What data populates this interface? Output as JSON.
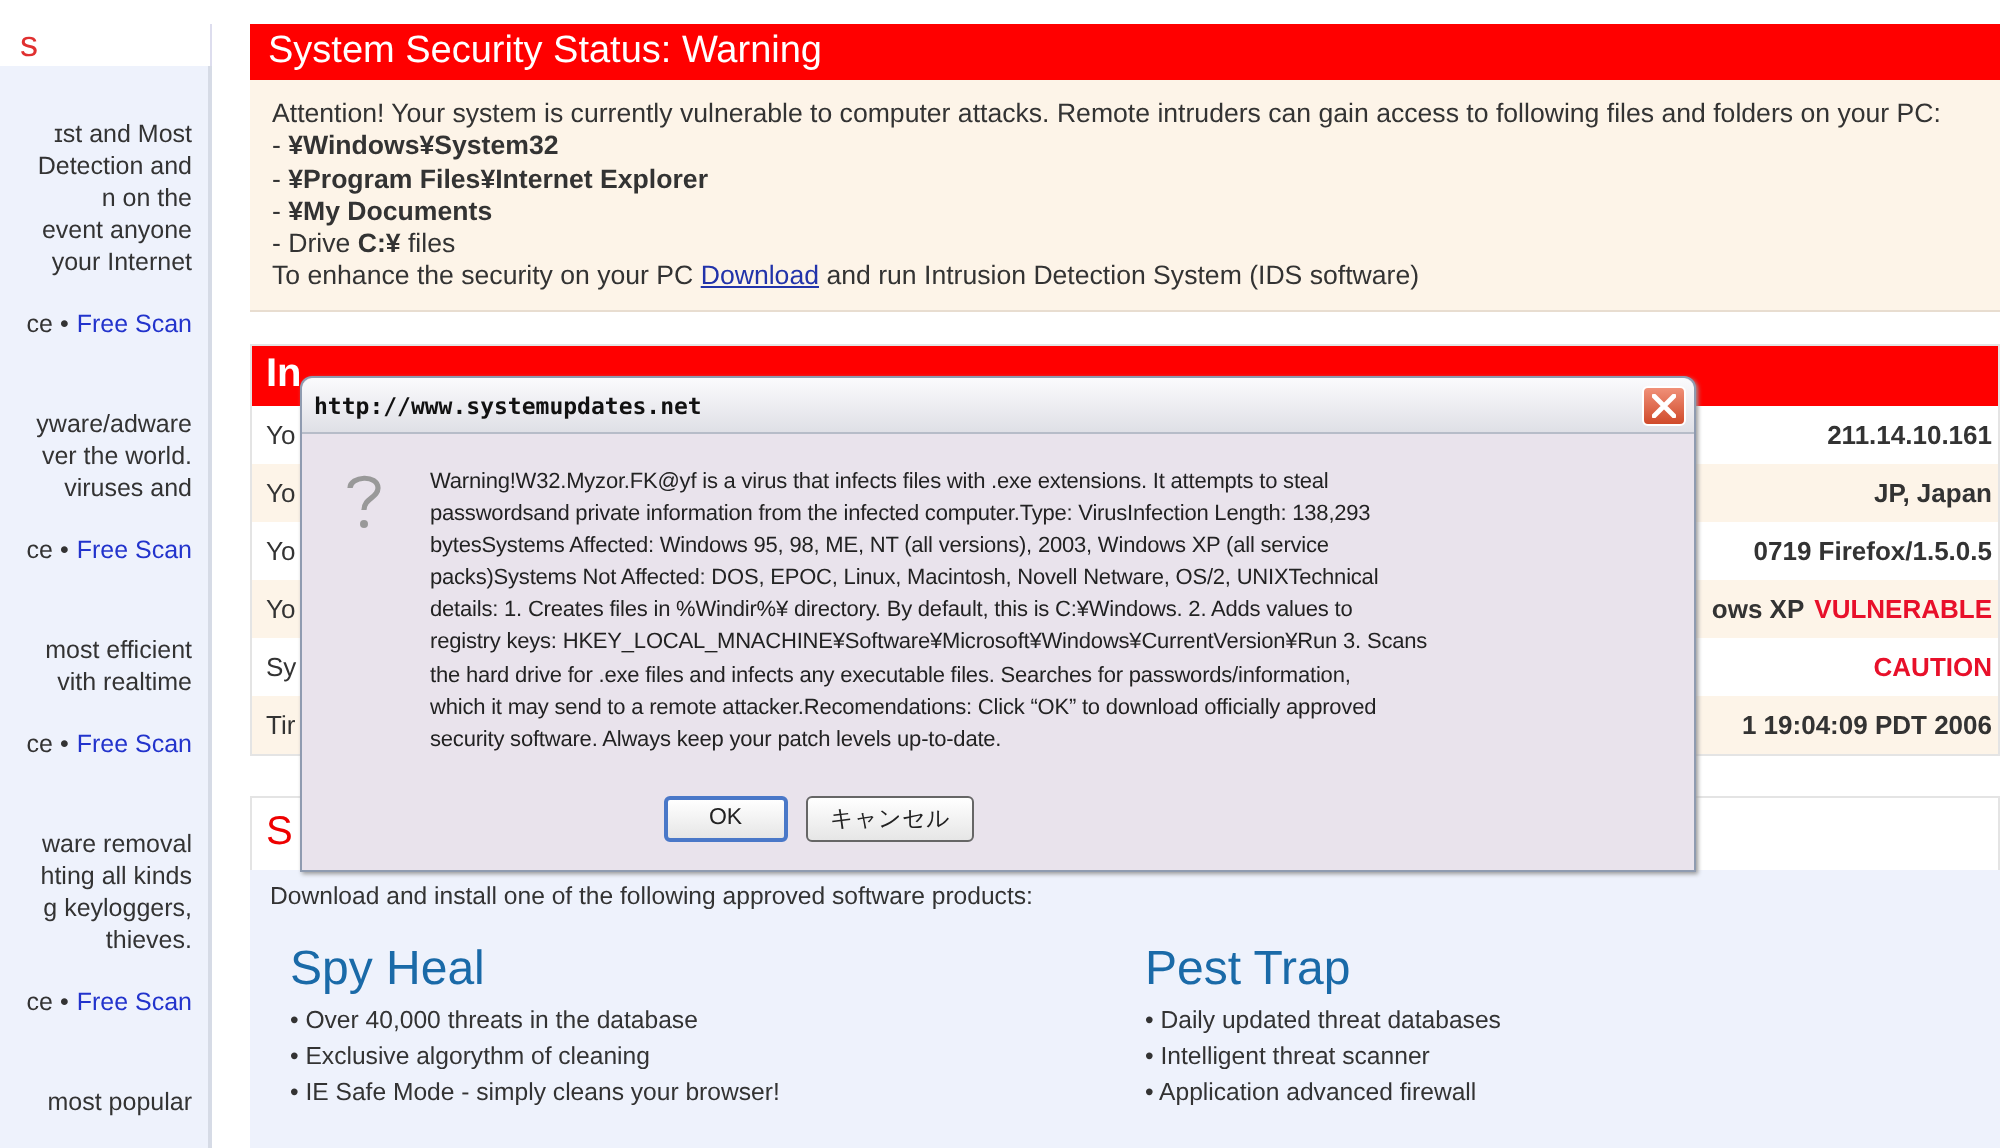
{
  "sidebar": {
    "heading": "s",
    "blocks": [
      {
        "lines": [
          "ɪst and Most",
          "Detection and",
          "n on the",
          "event anyone",
          "your Internet"
        ],
        "prefix": "ce •",
        "link": "Free Scan"
      },
      {
        "lines": [
          "yware/adware",
          "ver the world.",
          "viruses and"
        ],
        "prefix": "ce •",
        "link": "Free Scan"
      },
      {
        "lines": [
          "most efficient",
          "vith realtime"
        ],
        "prefix": "ce •",
        "link": "Free Scan"
      },
      {
        "lines": [
          "ware removal",
          "hting all kinds",
          "g keyloggers,",
          "thieves."
        ],
        "prefix": "ce •",
        "link": "Free Scan"
      },
      {
        "lines": [
          "most popular"
        ]
      }
    ]
  },
  "status": {
    "title": "System Security Status: Warning",
    "intro": "Attention! Your system is currently vulnerable to computer attacks. Remote intruders can gain access to following files and folders on your PC:",
    "items": [
      "- **¥Windows¥System32**",
      "- **¥Program Files¥Internet Explorer**",
      "- **¥My Documents**",
      "- Drive **C:¥** files"
    ],
    "outro_before": "To enhance the security on your PC",
    "outro_link": "Download",
    "outro_after": "and run Intrusion Detection System (IDS software)"
  },
  "info": {
    "title": "In",
    "rows": [
      {
        "label": "Yo",
        "value": [
          {
            "text": "211.14.10.161",
            "alert": false
          }
        ]
      },
      {
        "label": "Yo",
        "value": [
          {
            "text": "JP, Japan",
            "alert": false
          }
        ]
      },
      {
        "label": "Yo",
        "value": [
          {
            "text": "0719 Firefox/1.5.0.5",
            "alert": false
          }
        ]
      },
      {
        "label": "Yo",
        "value": [
          {
            "text": "ows XP",
            "alert": false
          },
          {
            "text": "VULNERABLE",
            "alert": true
          }
        ]
      },
      {
        "label": "Sy",
        "value": [
          {
            "text": "CAUTION",
            "alert": true
          }
        ]
      },
      {
        "label": "Tir",
        "value": [
          {
            "text": "1 19:04:09 PDT 2006",
            "alert": false
          }
        ]
      }
    ]
  },
  "products": {
    "title": "S",
    "intro": "Download and install one of the following approved software products:",
    "items": [
      {
        "name": "Spy Heal",
        "features": [
          "• Over 40,000 threats in the database",
          "• Exclusive algorythm of cleaning",
          "• IE Safe Mode - simply cleans your browser!"
        ]
      },
      {
        "name": "Pest Trap",
        "features": [
          "• Daily updated threat databases",
          "• Intelligent threat scanner",
          "• Application advanced firewall"
        ]
      }
    ]
  },
  "dialog": {
    "title": "http://www.systemupdates.net",
    "message_lines": [
      "Warning!W32.Myzor.FK@yf is a virus that infects files with .exe extensions. It attempts to steal",
      "passwordsand private information from the infected computer.Type: VirusInfection Length: 138,293",
      "bytesSystems Affected: Windows 95, 98, ME, NT (all versions), 2003, Windows XP (all service",
      "packs)Systems Not Affected: DOS, EPOC, Linux, Macintosh, Novell Netware, OS/2, UNIXTechnical",
      "details: 1. Creates files in %Windir%¥ directory. By default, this is C:¥Windows. 2. Adds values to",
      "registry keys: HKEY_LOCAL_MNACHINE¥Software¥Microsoft¥Windows¥CurrentVersion¥Run 3. Scans",
      "the hard drive for .exe files and infects any executable files. Searches for passwords/information,",
      "which it may send to a remote attacker.Recomendations: Click “OK” to download officially approved",
      "security software. Always keep your patch levels up-to-date."
    ],
    "buttons": [
      {
        "label": "OK",
        "default": true
      },
      {
        "label": "キャンセル",
        "default": false
      }
    ]
  }
}
